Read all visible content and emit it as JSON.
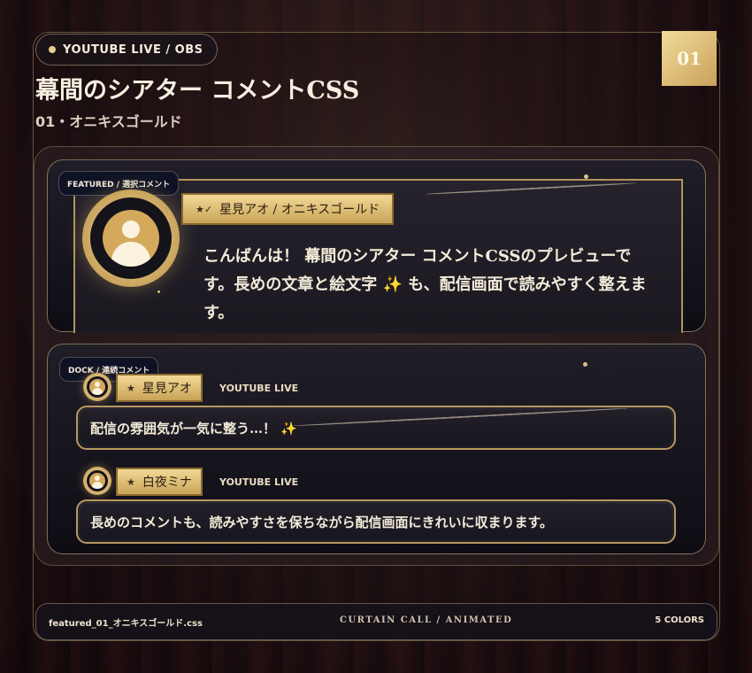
{
  "header": {
    "platform_badge": "YOUTUBE LIVE / OBS",
    "number": "01",
    "title": "幕間のシアター コメントCSS",
    "subtitle": "01・オニキスゴールド"
  },
  "featured": {
    "tag": "FEATURED / 選択コメント",
    "name_icons": "★✓",
    "name": "星見アオ / オニキスゴールド",
    "message": "こんばんは！ 幕間のシアター コメントCSSのプレビューです。長めの文章と絵文字 ✨ も、配信画面で読みやすく整えます。"
  },
  "dock": {
    "tag": "DOCK / 連続コメント",
    "comments": [
      {
        "star": "★",
        "name": "星見アオ",
        "platform": "YOUTUBE LIVE",
        "message": "配信の雰囲気が一気に整う…！ ✨"
      },
      {
        "star": "★",
        "name": "白夜ミナ",
        "platform": "YOUTUBE LIVE",
        "message": "長めのコメントも、読みやすさを保ちながら配信画面にきれいに収まります。"
      }
    ]
  },
  "footer": {
    "filename": "featured_01_オニキスゴールド.css",
    "center": "CURTAIN CALL / ANIMATED",
    "colors": "5 COLORS"
  },
  "colors": {
    "gold": "#c9a458",
    "gold_light": "#f2d896",
    "panel": "#17151d",
    "tag_bg": "#0f1225"
  }
}
